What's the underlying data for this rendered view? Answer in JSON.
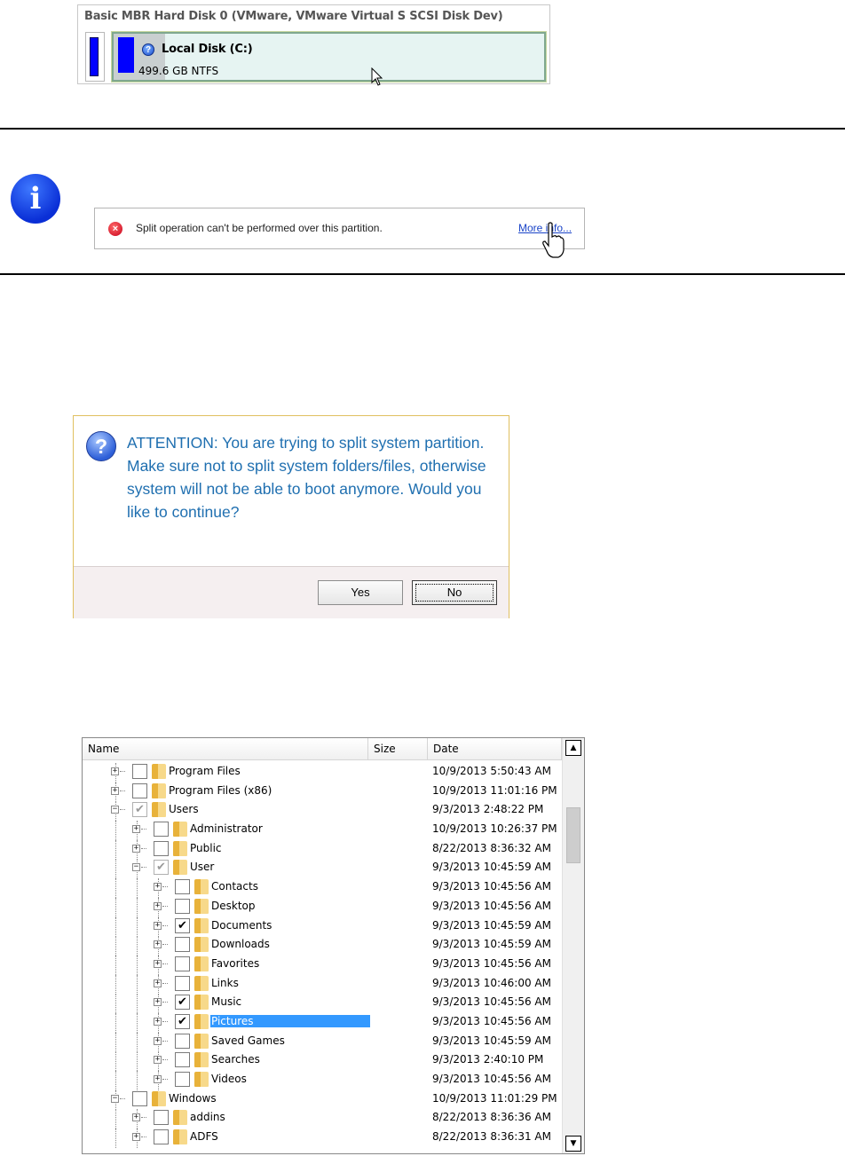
{
  "disk_map": {
    "title": "Basic MBR Hard Disk 0 (VMware, VMware Virtual S SCSI Disk Dev)",
    "partition_name": "Local Disk (C:)",
    "partition_size": "499.6 GB NTFS",
    "partition_color": "#0000ff"
  },
  "note": {
    "error_text": "Split operation can't be performed over this partition.",
    "more_info_label": "More info..."
  },
  "dialog": {
    "message": "ATTENTION: You are trying to split system partition. Make sure not to split system folders/files, otherwise system will not be able to boot anymore. Would you like to continue?",
    "yes_label": "Yes",
    "no_label": "No",
    "accent_color": "#1f6fb0"
  },
  "tree": {
    "columns": {
      "name": "Name",
      "size": "Size",
      "date": "Date"
    },
    "rows": [
      {
        "name": "Program Files",
        "date": "10/9/2013 5:50:43 AM",
        "level": 0,
        "expander": "+",
        "checked": "none"
      },
      {
        "name": "Program Files (x86)",
        "date": "10/9/2013 11:01:16 PM",
        "level": 0,
        "expander": "+",
        "checked": "none"
      },
      {
        "name": "Users",
        "date": "9/3/2013 2:48:22 PM",
        "level": 0,
        "expander": "-",
        "checked": "partial"
      },
      {
        "name": "Administrator",
        "date": "10/9/2013 10:26:37 PM",
        "level": 1,
        "expander": "+",
        "checked": "none"
      },
      {
        "name": "Public",
        "date": "8/22/2013 8:36:32 AM",
        "level": 1,
        "expander": "+",
        "checked": "none"
      },
      {
        "name": "User",
        "date": "9/3/2013 10:45:59 AM",
        "level": 1,
        "expander": "-",
        "checked": "partial"
      },
      {
        "name": "Contacts",
        "date": "9/3/2013 10:45:56 AM",
        "level": 2,
        "expander": "+",
        "checked": "none"
      },
      {
        "name": "Desktop",
        "date": "9/3/2013 10:45:56 AM",
        "level": 2,
        "expander": "+",
        "checked": "none"
      },
      {
        "name": "Documents",
        "date": "9/3/2013 10:45:59 AM",
        "level": 2,
        "expander": "+",
        "checked": "full"
      },
      {
        "name": "Downloads",
        "date": "9/3/2013 10:45:59 AM",
        "level": 2,
        "expander": "+",
        "checked": "none"
      },
      {
        "name": "Favorites",
        "date": "9/3/2013 10:45:56 AM",
        "level": 2,
        "expander": "+",
        "checked": "none"
      },
      {
        "name": "Links",
        "date": "9/3/2013 10:46:00 AM",
        "level": 2,
        "expander": "+",
        "checked": "none"
      },
      {
        "name": "Music",
        "date": "9/3/2013 10:45:56 AM",
        "level": 2,
        "expander": "+",
        "checked": "full"
      },
      {
        "name": "Pictures",
        "date": "9/3/2013 10:45:56 AM",
        "level": 2,
        "expander": "+",
        "checked": "full",
        "selected": true
      },
      {
        "name": "Saved Games",
        "date": "9/3/2013 10:45:59 AM",
        "level": 2,
        "expander": "+",
        "checked": "none"
      },
      {
        "name": "Searches",
        "date": "9/3/2013 2:40:10 PM",
        "level": 2,
        "expander": "+",
        "checked": "none"
      },
      {
        "name": "Videos",
        "date": "9/3/2013 10:45:56 AM",
        "level": 2,
        "expander": "+",
        "checked": "none"
      },
      {
        "name": "Windows",
        "date": "10/9/2013 11:01:29 PM",
        "level": 0,
        "expander": "-",
        "checked": "none"
      },
      {
        "name": "addins",
        "date": "8/22/2013 8:36:36 AM",
        "level": 1,
        "expander": "+",
        "checked": "none"
      },
      {
        "name": "ADFS",
        "date": "8/22/2013 8:36:31 AM",
        "level": 1,
        "expander": "+",
        "checked": "none"
      }
    ],
    "selection_color": "#3399ff"
  }
}
